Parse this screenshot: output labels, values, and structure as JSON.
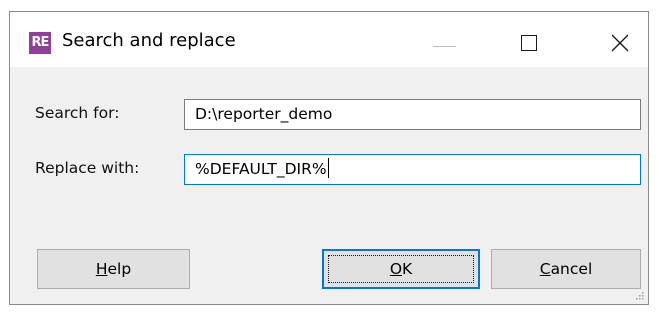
{
  "window": {
    "title": "Search and replace",
    "app_icon_text": "RE",
    "app_icon_color": "#8e3f99"
  },
  "form": {
    "search_label": "Search for:",
    "search_value": "D:\\reporter_demo",
    "replace_label": "Replace with:",
    "replace_value": "%DEFAULT_DIR%"
  },
  "buttons": {
    "help_label_underlined": "H",
    "help_label_rest": "elp",
    "ok_label_underlined": "O",
    "ok_label_rest": "K",
    "cancel_label_underlined": "C",
    "cancel_label_rest": "ancel"
  },
  "colors": {
    "focus_accent": "#0078d7",
    "button_face": "#e1e1e1",
    "dialog_background": "#f0f0f0"
  }
}
